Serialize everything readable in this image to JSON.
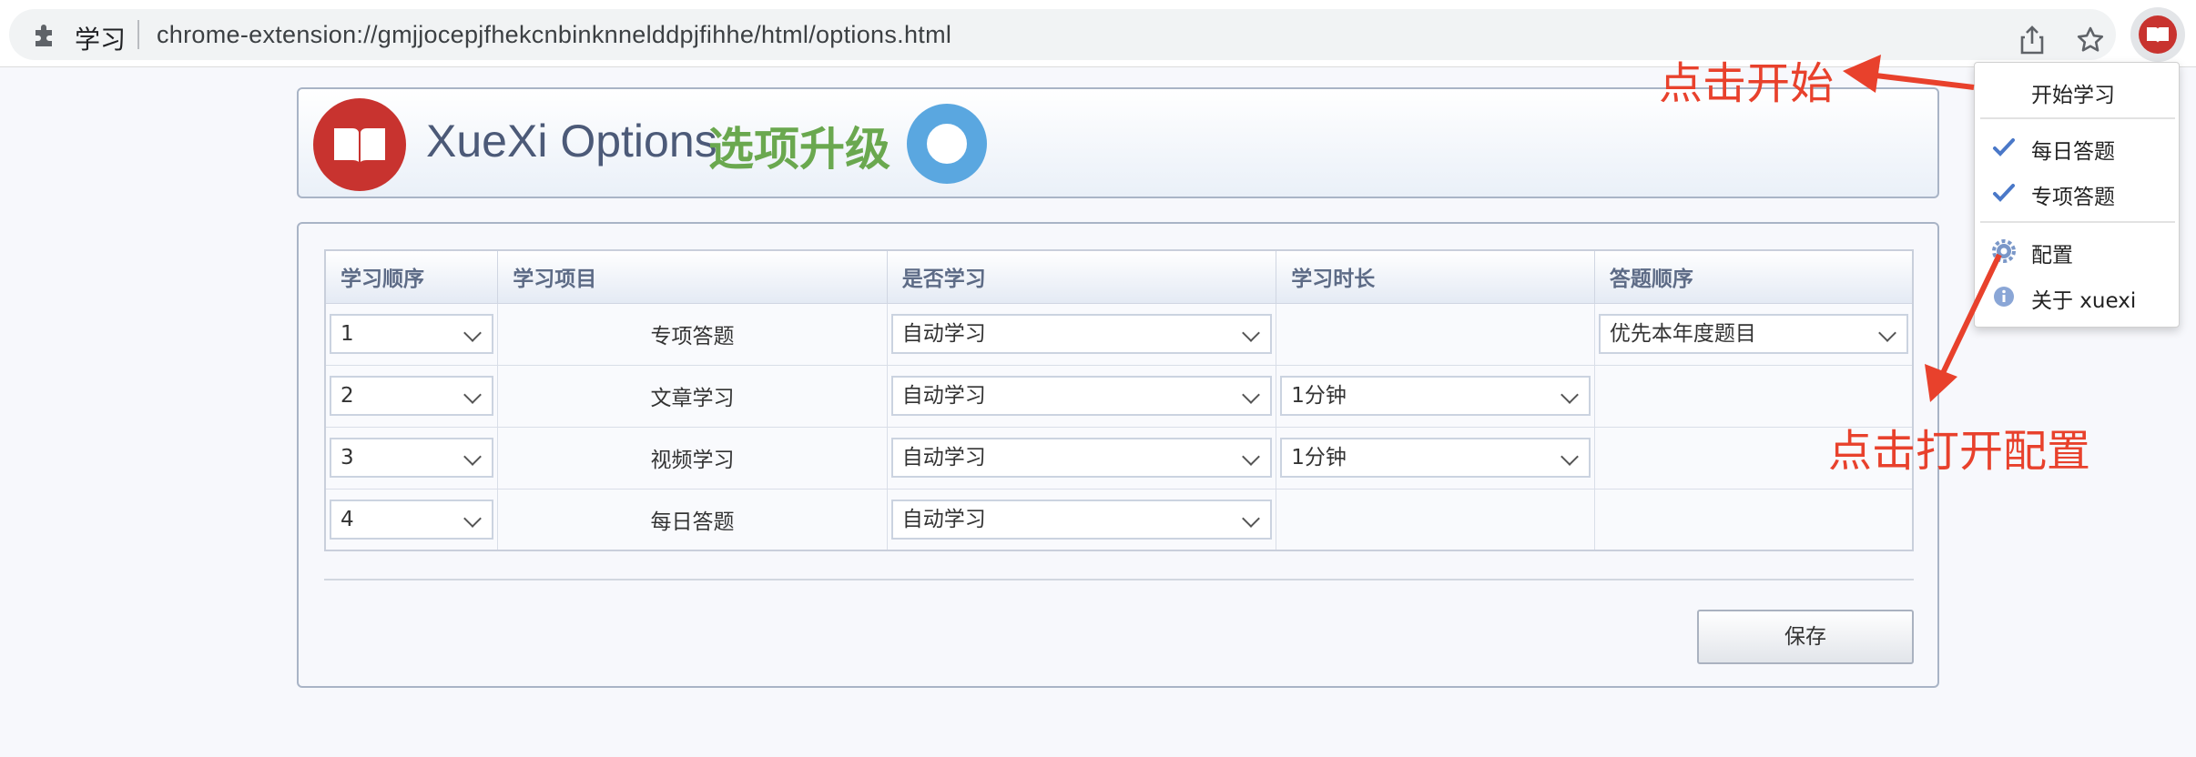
{
  "browser": {
    "site_name": "学习",
    "url": "chrome-extension://gmjjocepjfhekcnbinknnelddpjfihhe/html/options.html",
    "icons": {
      "extension": "puzzle-icon",
      "share": "share-icon",
      "bookmark": "star-icon",
      "app": "book-logo-icon"
    }
  },
  "header": {
    "title": "XueXi Options",
    "subtitle": "选项升级"
  },
  "table": {
    "headers": [
      "学习顺序",
      "学习项目",
      "是否学习",
      "学习时长",
      "答题顺序"
    ],
    "rows": [
      {
        "order": "1",
        "item": "专项答题",
        "mode": "自动学习",
        "duration": "",
        "answer_order": "优先本年度题目"
      },
      {
        "order": "2",
        "item": "文章学习",
        "mode": "自动学习",
        "duration": "1分钟",
        "answer_order": ""
      },
      {
        "order": "3",
        "item": "视频学习",
        "mode": "自动学习",
        "duration": "1分钟",
        "answer_order": ""
      },
      {
        "order": "4",
        "item": "每日答题",
        "mode": "自动学习",
        "duration": "",
        "answer_order": ""
      }
    ]
  },
  "save_label": "保存",
  "menu": {
    "items": [
      {
        "label": "开始学习",
        "icon": ""
      },
      {
        "label": "每日答题",
        "icon": "check-icon"
      },
      {
        "label": "专项答题",
        "icon": "check-icon"
      },
      {
        "label": "配置",
        "icon": "gear-icon"
      },
      {
        "label": "关于 xuexi",
        "icon": "info-icon"
      }
    ]
  },
  "annotations": {
    "start": "点击开始",
    "open_config": "点击打开配置"
  },
  "colors": {
    "accent_red": "#e8412c",
    "logo_red": "#c8332f",
    "subtitle_green": "#6aa84f",
    "spinner_blue": "#5aa7e0",
    "check_blue": "#4a78c8"
  }
}
